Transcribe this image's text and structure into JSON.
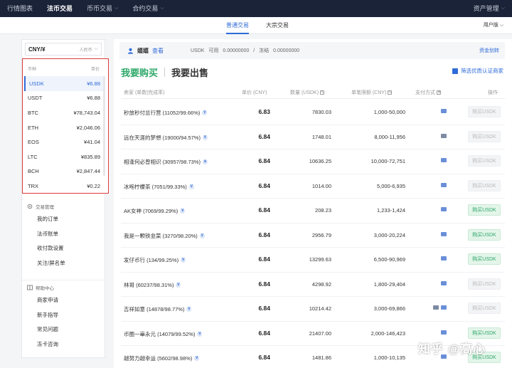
{
  "topnav": {
    "items": [
      {
        "label": "行情图表",
        "active": false,
        "dropdown": false
      },
      {
        "label": "法币交易",
        "active": true,
        "dropdown": false
      },
      {
        "label": "币币交易",
        "active": false,
        "dropdown": true
      },
      {
        "label": "合约交易",
        "active": false,
        "dropdown": true
      }
    ],
    "right_label": "资产管理"
  },
  "subnav": {
    "tabs": [
      {
        "label": "普通交易",
        "active": true
      },
      {
        "label": "大宗交易",
        "active": false
      }
    ],
    "version_label": "用户版"
  },
  "sidebar": {
    "currency_select": {
      "value": "CNY/¥",
      "sub": "人民币"
    },
    "coin_header": {
      "name": "币种",
      "price": "单价"
    },
    "coins": [
      {
        "name": "USDK",
        "price": "¥6.88",
        "active": true
      },
      {
        "name": "USDT",
        "price": "¥6.88",
        "active": false
      },
      {
        "name": "BTC",
        "price": "¥78,743.04",
        "active": false
      },
      {
        "name": "ETH",
        "price": "¥2,046.06",
        "active": false
      },
      {
        "name": "EOS",
        "price": "¥41.04",
        "active": false
      },
      {
        "name": "LTC",
        "price": "¥835.89",
        "active": false
      },
      {
        "name": "BCH",
        "price": "¥2,847.44",
        "active": false
      },
      {
        "name": "TRX",
        "price": "¥0.22",
        "active": false
      }
    ],
    "trade_mgmt": {
      "title": "交易管理",
      "items": [
        "我的订单",
        "法币账单",
        "收付款设置",
        "关注/屏名单"
      ]
    },
    "help_center": {
      "title": "帮助中心",
      "items": [
        "商家申请",
        "新手指导",
        "常见问题",
        "冻卡咨询"
      ]
    }
  },
  "account_bar": {
    "username": "嬉嬉",
    "view_label": "查看",
    "currency": "USDK",
    "available_label": "可用",
    "available": "0.00000000",
    "frozen_label": "冻结",
    "frozen": "0.00000000",
    "transfer_label": "资金划转"
  },
  "mode_tabs": {
    "buy": "我要购买",
    "sell": "我要出售"
  },
  "filter_label": "筛选优质认证商家",
  "table": {
    "headers": {
      "seller": "卖家 (单数|完成率)",
      "price": "单价 (CNY)",
      "qty": "数量 (USDK)",
      "limit": "单笔限额 (CNY)",
      "pay": "支付方式",
      "action": "操作"
    },
    "rows": [
      {
        "seller": "秒放秒付总行营 (11052/99.66%)",
        "badge": "V",
        "price": "6.83",
        "qty": "7830.03",
        "limit": "1,000-50,000",
        "pay": [
          "alipay"
        ],
        "action": "购买USDK",
        "enabled": false
      },
      {
        "seller": "远在天涯的梦想 (19000/94.57%)",
        "badge": "V",
        "price": "6.84",
        "qty": "1748.01",
        "limit": "8,000-11,956",
        "pay": [
          "bank"
        ],
        "action": "购买USDK",
        "enabled": false
      },
      {
        "seller": "相逢何必曾相识 (30957/98.73%)",
        "badge": "♛",
        "price": "6.84",
        "qty": "10636.25",
        "limit": "10,000-72,751",
        "pay": [
          "alipay"
        ],
        "action": "购买USDK",
        "enabled": false
      },
      {
        "seller": "冰咆柠檬茶 (7051/99.33%)",
        "badge": "V",
        "price": "6.84",
        "qty": "1014.00",
        "limit": "5,000-6,935",
        "pay": [
          "alipay"
        ],
        "action": "购买USDK",
        "enabled": false
      },
      {
        "seller": "AK女神 (7069/99.29%)",
        "badge": "V",
        "price": "6.84",
        "qty": "208.23",
        "limit": "1,233-1,424",
        "pay": [
          "alipay"
        ],
        "action": "购买USDK",
        "enabled": true
      },
      {
        "seller": "我是一颗铁韭菜 (3270/98.20%)",
        "badge": "V",
        "price": "6.84",
        "qty": "2956.79",
        "limit": "3,000-20,224",
        "pay": [
          "alipay"
        ],
        "action": "购买USDK",
        "enabled": true
      },
      {
        "seller": "发仔币行 (134/99.25%)",
        "badge": "V",
        "price": "6.84",
        "qty": "13299.63",
        "limit": "6,500-90,969",
        "pay": [
          "alipay"
        ],
        "action": "购买USDK",
        "enabled": true
      },
      {
        "seller": "林哥 (60237/98.31%)",
        "badge": "V",
        "price": "6.84",
        "qty": "4298.92",
        "limit": "1,800-29,404",
        "pay": [
          "alipay"
        ],
        "action": "购买USDK",
        "enabled": false
      },
      {
        "seller": "吉祥如意 (14878/98.77%)",
        "badge": "V",
        "price": "6.84",
        "qty": "10214.42",
        "limit": "3,000-69,866",
        "pay": [
          "bank",
          "alipay"
        ],
        "action": "购买USDK",
        "enabled": false
      },
      {
        "seller": "币圈一崋永元 (14079/99.52%)",
        "badge": "V",
        "price": "6.84",
        "qty": "21407.00",
        "limit": "2,000-146,423",
        "pay": [
          "alipay"
        ],
        "action": "购买USDK",
        "enabled": true
      },
      {
        "seller": "越努力越幸运 (5602/98.98%)",
        "badge": "V",
        "price": "6.84",
        "qty": "1481.86",
        "limit": "1,000-10,135",
        "pay": [
          "alipay"
        ],
        "action": "购买USDK",
        "enabled": true
      }
    ]
  },
  "watermark": "知乎 @高心",
  "colors": {
    "accent": "#2f6bd8",
    "buy_green": "#2fa86a",
    "highlight_border": "#e03c3c",
    "nav_bg": "#1b2338"
  }
}
